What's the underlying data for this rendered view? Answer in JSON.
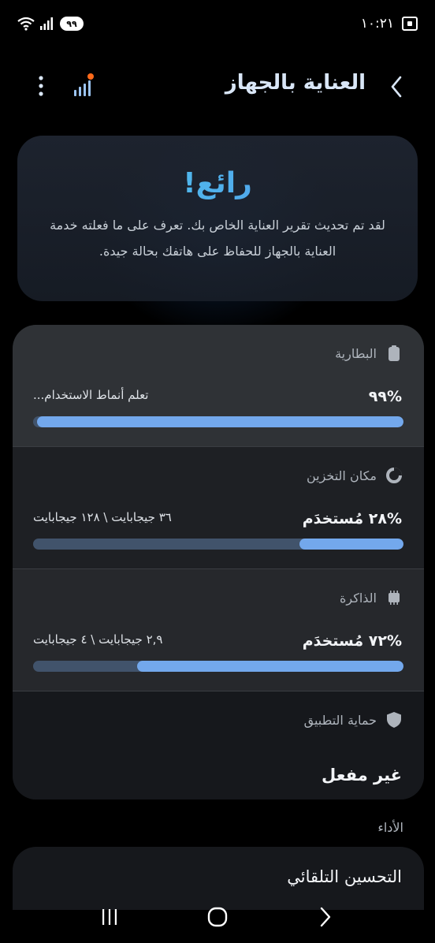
{
  "status_bar": {
    "time": "١٠:٢١",
    "battery_level": "٩٩"
  },
  "header": {
    "title": "العناية بالجهاز",
    "back_icon": "chevron-left-icon",
    "diagnostics_icon": "signal-bars-icon",
    "more_icon": "more-vertical-icon"
  },
  "hero": {
    "title": "رائع!",
    "description": "لقد تم تحديث تقرير العناية الخاص بك. تعرف على ما فعلته خدمة العناية بالجهاز للحفاظ على هاتفك بحالة جيدة."
  },
  "sections": {
    "battery": {
      "label": "البطارية",
      "value": "%٩٩",
      "sub": "تعلم أنماط الاستخدام...",
      "percent": 99
    },
    "storage": {
      "label": "مكان التخزين",
      "value": "%٢٨ مُستخدَم",
      "sub": "٣٦ جيجابايت \\ ١٢٨ جيجابايت",
      "percent": 28
    },
    "memory": {
      "label": "الذاكرة",
      "value": "%٧٢ مُستخدَم",
      "sub": "٢,٩ جيجابايت \\ ٤ جيجابايت",
      "percent": 72
    },
    "app_protection": {
      "label": "حماية التطبيق",
      "value": "غير مفعل"
    }
  },
  "performance": {
    "label": "الأداء",
    "auto_optimization": "التحسين التلقائي"
  },
  "colors": {
    "accent": "#73a8ec",
    "bar_track": "#41536b",
    "hero_gradient_start": "#52d2e8",
    "hero_gradient_end": "#4e8ef0"
  }
}
